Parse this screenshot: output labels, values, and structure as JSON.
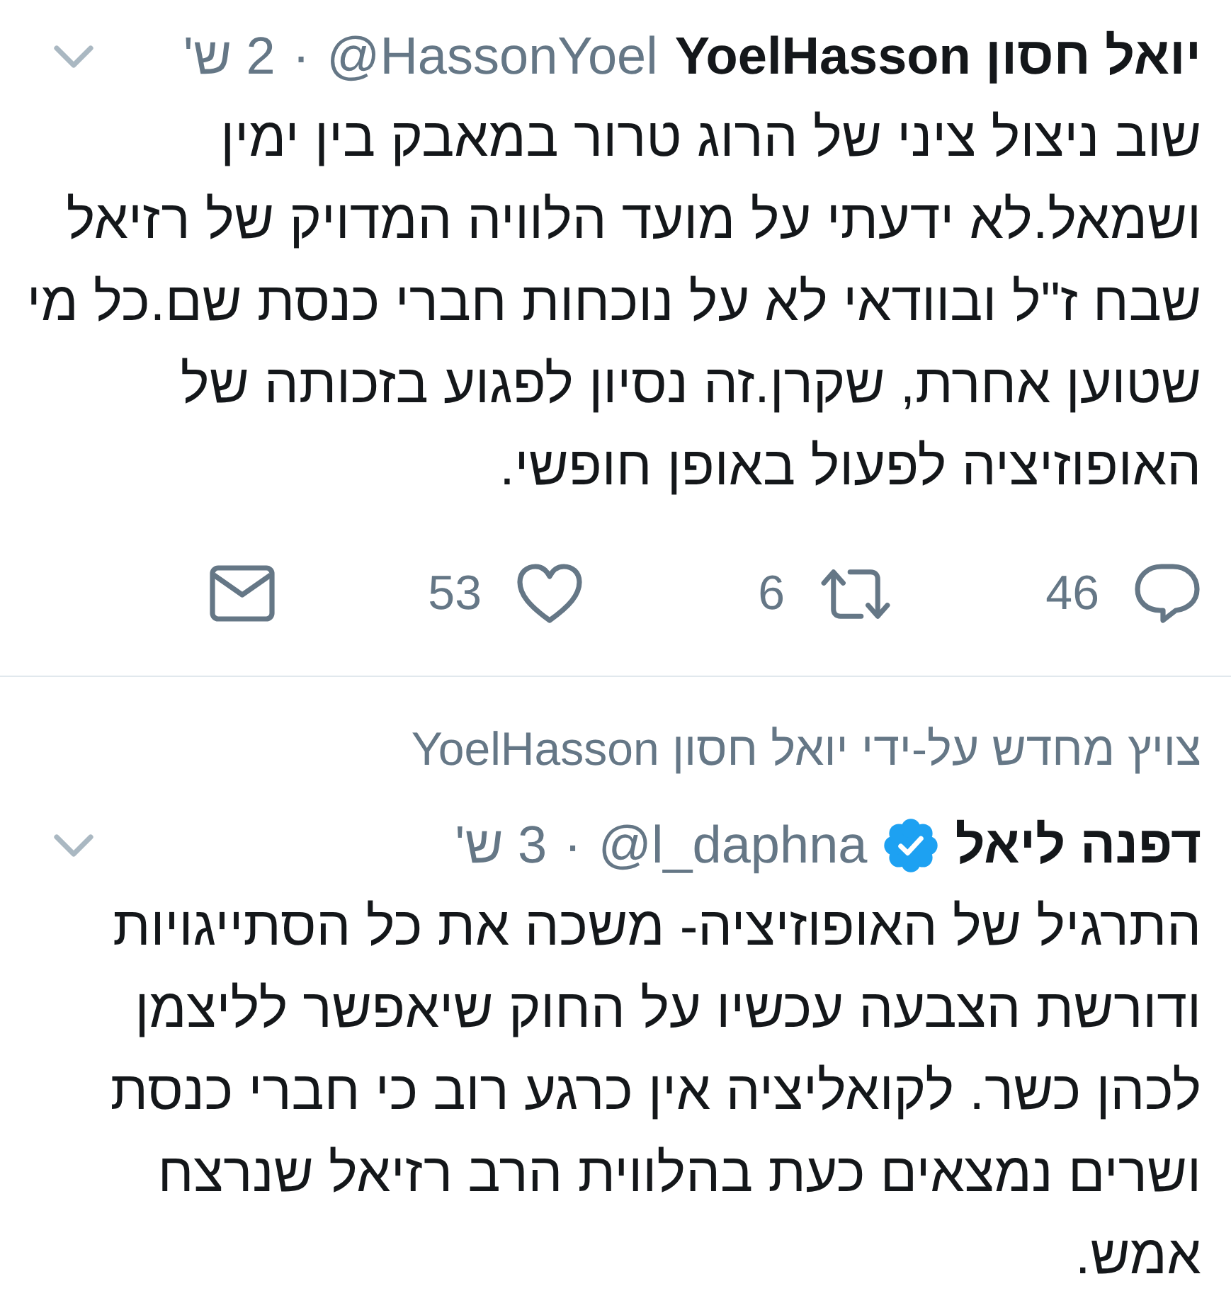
{
  "tweets": [
    {
      "author_name": "יואל חסון YoelHasson",
      "verified": false,
      "handle": "@HassonYoel",
      "separator": "·",
      "time": "2 ש'",
      "text": "שוב ניצול ציני של הרוג טרור במאבק בין ימין ושמאל.לא ידעתי על מועד הלוויה המדויק של רזיאל שבח ז\"ל ובוודאי לא על נוכחות חברי כנסת שם.כל מי שטוען אחרת, שקרן.זה נסיון לפגוע בזכותה של האופוזיציה לפעול באופן חופשי.",
      "actions": [
        {
          "kind": "reply",
          "count": "46"
        },
        {
          "kind": "retweet",
          "count": "6"
        },
        {
          "kind": "like",
          "count": "53"
        },
        {
          "kind": "message"
        }
      ]
    },
    {
      "social_context": "צויץ מחדש על-ידי יואל חסון YoelHasson",
      "author_name": "דפנה ליאל",
      "verified": true,
      "handle": "@l_daphna",
      "separator": "·",
      "time": "3 ש'",
      "text": "התרגיל של האופוזיציה- משכה את כל הסתייגויות ודורשת הצבעה עכשיו על החוק שיאפשר לליצמן לכהן כשר. לקואליציה אין כרגע רוב כי חברי כנסת ושרים נמצאים כעת בהלווית הרב רזיאל שנרצח אמש."
    }
  ]
}
